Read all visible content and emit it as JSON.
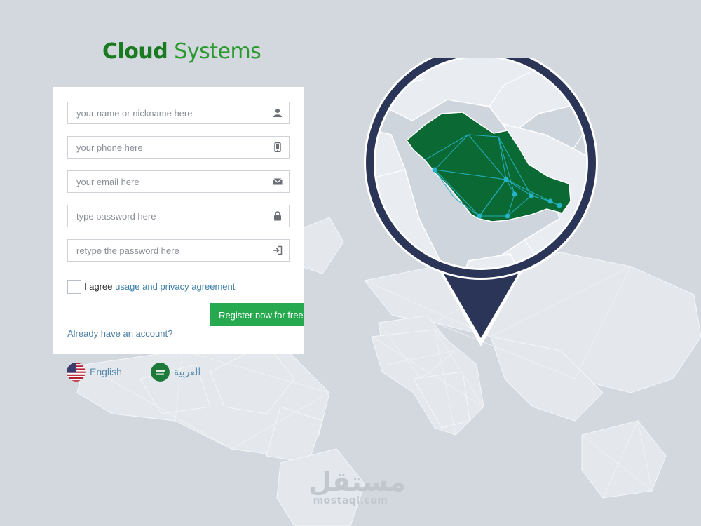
{
  "brand": {
    "word1": "Cloud",
    "word2": "Systems"
  },
  "colors": {
    "brand_green": "#1f8a2a",
    "register_green": "#27a94f",
    "link_blue": "#4b7fa3",
    "pin_navy": "#2b3558",
    "saudi_green": "#0b6a33",
    "node_cyan": "#25b3c7",
    "background": "#d3d8df"
  },
  "form": {
    "fields": [
      {
        "placeholder": "your name or nickname here",
        "icon": "user-icon"
      },
      {
        "placeholder": "your phone here",
        "icon": "phone-icon"
      },
      {
        "placeholder": "your email here",
        "icon": "envelope-icon"
      },
      {
        "placeholder": "type password here",
        "icon": "lock-icon"
      },
      {
        "placeholder": "retype the password here",
        "icon": "sign-in-icon"
      }
    ],
    "agree_prefix": "I agree",
    "agree_link": "usage and privacy agreement",
    "register_label": "Register now for free",
    "login_link": "Already have an account?"
  },
  "languages": [
    {
      "label": "English",
      "icon": "us-flag-icon"
    },
    {
      "label": "العربية",
      "icon": "saudi-flag-icon"
    }
  ],
  "watermark": {
    "arabic": "مستقل",
    "url": "mostaql.com"
  }
}
